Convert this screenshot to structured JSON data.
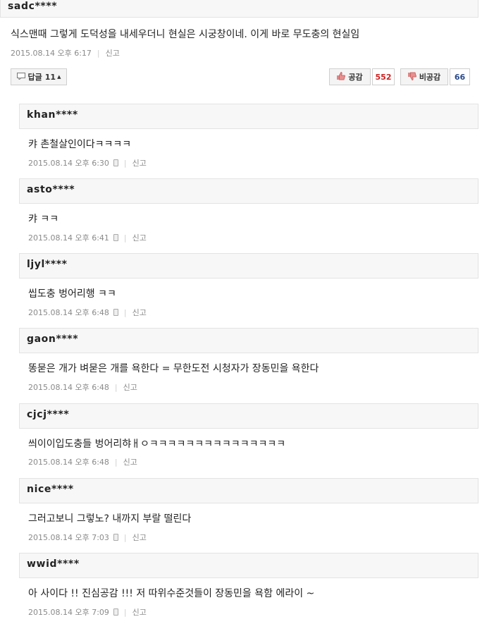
{
  "main_comment": {
    "username": "sadc****",
    "text": "식스맨때 그렇게 도덕성을 내세우더니 현실은 시궁창이네. 이게 바로 무도충의 현실임",
    "timestamp": "2015.08.14 오후 6:17",
    "report_label": "신고",
    "reply_label": "답글",
    "reply_count": "11",
    "like_label": "공감",
    "like_count": "552",
    "dislike_label": "비공감",
    "dislike_count": "66"
  },
  "replies": [
    {
      "username": "khan****",
      "text": "캬 촌철살인이다ㅋㅋㅋㅋ",
      "timestamp": "2015.08.14 오후 6:30",
      "mobile": true,
      "report_label": "신고"
    },
    {
      "username": "asto****",
      "text": "캬 ㅋㅋ",
      "timestamp": "2015.08.14 오후 6:41",
      "mobile": true,
      "report_label": "신고"
    },
    {
      "username": "ljyl****",
      "text": "씹도충 벙어리행 ㅋㅋ",
      "timestamp": "2015.08.14 오후 6:48",
      "mobile": true,
      "report_label": "신고"
    },
    {
      "username": "gaon****",
      "text": "똥묻은 개가 벼묻은 개를 욕한다 = 무한도전 시청자가 장동민을 욕한다",
      "timestamp": "2015.08.14 오후 6:48",
      "mobile": false,
      "report_label": "신고"
    },
    {
      "username": "cjcj****",
      "text": "씌이이입도충들 벙어리햐ㅐㅇㅋㅋㅋㅋㅋㅋㅋㅋㅋㅋㅋㅋㅋㅋㅋ",
      "timestamp": "2015.08.14 오후 6:48",
      "mobile": false,
      "report_label": "신고"
    },
    {
      "username": "nice****",
      "text": "그러고보니 그렇노? 내까지 부랄 떨린다",
      "timestamp": "2015.08.14 오후 7:03",
      "mobile": true,
      "report_label": "신고"
    },
    {
      "username": "wwid****",
      "text": "아 사이다 !! 진심공감 !!! 저 따위수준것들이 장동민을 욕함 에라이 ~",
      "timestamp": "2015.08.14 오후 7:09",
      "mobile": true,
      "report_label": "신고"
    }
  ],
  "colors": {
    "like_count": "#cc2222",
    "dislike_count": "#2a4a8a"
  }
}
